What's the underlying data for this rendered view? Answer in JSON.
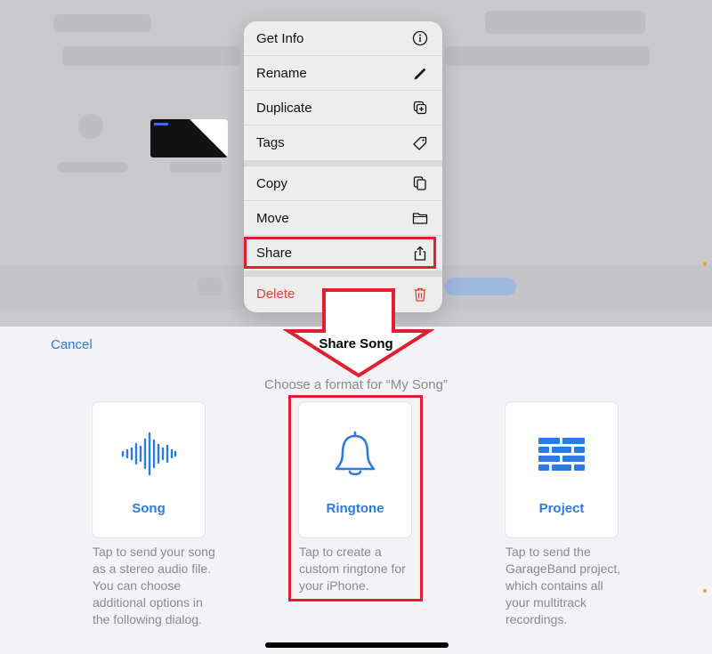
{
  "context_menu": {
    "items": [
      {
        "label": "Get Info",
        "icon": "info-icon"
      },
      {
        "label": "Rename",
        "icon": "pencil-icon"
      },
      {
        "label": "Duplicate",
        "icon": "duplicate-icon"
      },
      {
        "label": "Tags",
        "icon": "tag-icon"
      },
      {
        "label": "Copy",
        "icon": "copy-icon"
      },
      {
        "label": "Move",
        "icon": "folder-icon"
      },
      {
        "label": "Share",
        "icon": "share-icon"
      },
      {
        "label": "Delete",
        "icon": "trash-icon"
      }
    ]
  },
  "share_sheet": {
    "cancel_label": "Cancel",
    "title": "Share Song",
    "subtitle": "Choose a format for “My Song”",
    "options": [
      {
        "label": "Song",
        "icon": "waveform-icon",
        "description": "Tap to send your song as a stereo audio file. You can choose additional options in the following dialog."
      },
      {
        "label": "Ringtone",
        "icon": "bell-icon",
        "description": "Tap to create a custom ringtone for your iPhone."
      },
      {
        "label": "Project",
        "icon": "bricks-icon",
        "description": "Tap to send the GarageBand project, which contains all your multitrack recordings."
      }
    ]
  },
  "colors": {
    "accent": "#2c7be5",
    "highlight": "#e0202e",
    "danger": "#e0443a"
  }
}
